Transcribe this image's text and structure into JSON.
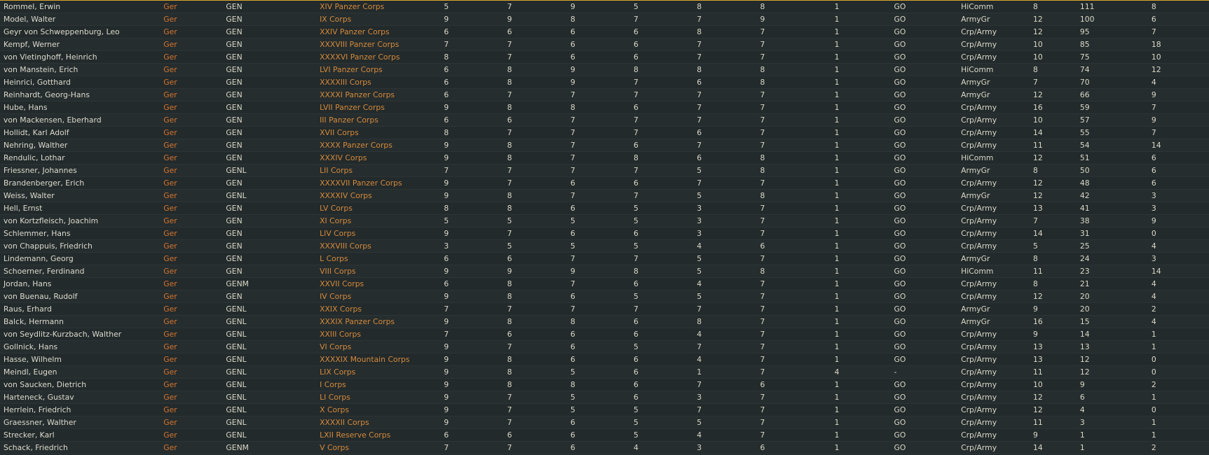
{
  "colors": {
    "background": "#232a2b",
    "row_alt": "#262d2e",
    "accent_rule": "#d7a631",
    "text": "#d9d9c9",
    "nationality": "#d4752e",
    "command": "#d48a3c"
  },
  "rows": [
    [
      "Rommel, Erwin",
      "Ger",
      "GEN",
      "XIV Panzer Corps",
      "5",
      "7",
      "9",
      "5",
      "8",
      "8",
      "1",
      "GO",
      "HiComm",
      "8",
      "111",
      "8"
    ],
    [
      "Model, Walter",
      "Ger",
      "GEN",
      "IX Corps",
      "9",
      "9",
      "8",
      "7",
      "7",
      "9",
      "1",
      "GO",
      "ArmyGr",
      "12",
      "100",
      "6"
    ],
    [
      "Geyr von Schweppenburg, Leo",
      "Ger",
      "GEN",
      "XXIV Panzer Corps",
      "6",
      "6",
      "6",
      "6",
      "8",
      "7",
      "1",
      "GO",
      "Crp/Army",
      "12",
      "95",
      "7"
    ],
    [
      "Kempf, Werner",
      "Ger",
      "GEN",
      "XXXVIII Panzer Corps",
      "7",
      "7",
      "6",
      "6",
      "7",
      "7",
      "1",
      "GO",
      "Crp/Army",
      "10",
      "85",
      "18"
    ],
    [
      "von Vietinghoff, Heinrich",
      "Ger",
      "GEN",
      "XXXXVI Panzer Corps",
      "8",
      "7",
      "6",
      "6",
      "7",
      "7",
      "1",
      "GO",
      "Crp/Army",
      "10",
      "75",
      "10"
    ],
    [
      "von Manstein, Erich",
      "Ger",
      "GEN",
      "LVI Panzer Corps",
      "6",
      "8",
      "9",
      "8",
      "8",
      "8",
      "1",
      "GO",
      "HiComm",
      "8",
      "74",
      "12"
    ],
    [
      "Heinrici, Gotthard",
      "Ger",
      "GEN",
      "XXXXIII Corps",
      "6",
      "8",
      "9",
      "7",
      "6",
      "8",
      "1",
      "GO",
      "ArmyGr",
      "7",
      "70",
      "4"
    ],
    [
      "Reinhardt, Georg-Hans",
      "Ger",
      "GEN",
      "XXXXI Panzer Corps",
      "6",
      "7",
      "7",
      "7",
      "7",
      "7",
      "1",
      "GO",
      "ArmyGr",
      "12",
      "66",
      "9"
    ],
    [
      "Hube, Hans",
      "Ger",
      "GEN",
      "LVII Panzer Corps",
      "9",
      "8",
      "8",
      "6",
      "7",
      "7",
      "1",
      "GO",
      "Crp/Army",
      "16",
      "59",
      "7"
    ],
    [
      "von Mackensen, Eberhard",
      "Ger",
      "GEN",
      "III Panzer Corps",
      "6",
      "6",
      "7",
      "7",
      "7",
      "7",
      "1",
      "GO",
      "Crp/Army",
      "10",
      "57",
      "9"
    ],
    [
      "Hollidt, Karl Adolf",
      "Ger",
      "GEN",
      "XVII Corps",
      "8",
      "7",
      "7",
      "7",
      "6",
      "7",
      "1",
      "GO",
      "Crp/Army",
      "14",
      "55",
      "7"
    ],
    [
      "Nehring, Walther",
      "Ger",
      "GEN",
      "XXXX Panzer Corps",
      "9",
      "8",
      "7",
      "6",
      "7",
      "7",
      "1",
      "GO",
      "Crp/Army",
      "11",
      "54",
      "14"
    ],
    [
      "Rendulic, Lothar",
      "Ger",
      "GEN",
      "XXXIV Corps",
      "9",
      "8",
      "7",
      "8",
      "6",
      "8",
      "1",
      "GO",
      "HiComm",
      "12",
      "51",
      "6"
    ],
    [
      "Friessner, Johannes",
      "Ger",
      "GENL",
      "LII Corps",
      "7",
      "7",
      "7",
      "7",
      "5",
      "8",
      "1",
      "GO",
      "ArmyGr",
      "8",
      "50",
      "6"
    ],
    [
      "Brandenberger, Erich",
      "Ger",
      "GEN",
      "XXXXVII Panzer Corps",
      "9",
      "7",
      "6",
      "6",
      "7",
      "7",
      "1",
      "GO",
      "Crp/Army",
      "12",
      "48",
      "6"
    ],
    [
      "Weiss, Walter",
      "Ger",
      "GENL",
      "XXXXIV Corps",
      "9",
      "8",
      "7",
      "7",
      "5",
      "8",
      "1",
      "GO",
      "ArmyGr",
      "12",
      "42",
      "3"
    ],
    [
      "Hell, Ernst",
      "Ger",
      "GEN",
      "LV Corps",
      "8",
      "8",
      "6",
      "5",
      "3",
      "7",
      "1",
      "GO",
      "Crp/Army",
      "13",
      "41",
      "3"
    ],
    [
      "von Kortzfleisch, Joachim",
      "Ger",
      "GEN",
      "XI Corps",
      "5",
      "5",
      "5",
      "5",
      "3",
      "7",
      "1",
      "GO",
      "Crp/Army",
      "7",
      "38",
      "9"
    ],
    [
      "Schlemmer, Hans",
      "Ger",
      "GEN",
      "LIV Corps",
      "9",
      "7",
      "6",
      "6",
      "3",
      "7",
      "1",
      "GO",
      "Crp/Army",
      "14",
      "31",
      "0"
    ],
    [
      "von Chappuis, Friedrich",
      "Ger",
      "GEN",
      "XXXVIII Corps",
      "3",
      "5",
      "5",
      "5",
      "4",
      "6",
      "1",
      "GO",
      "Crp/Army",
      "5",
      "25",
      "4"
    ],
    [
      "Lindemann, Georg",
      "Ger",
      "GEN",
      "L Corps",
      "6",
      "6",
      "7",
      "7",
      "5",
      "7",
      "1",
      "GO",
      "ArmyGr",
      "8",
      "24",
      "3"
    ],
    [
      "Schoerner, Ferdinand",
      "Ger",
      "GEN",
      "VIII Corps",
      "9",
      "9",
      "9",
      "8",
      "5",
      "8",
      "1",
      "GO",
      "HiComm",
      "11",
      "23",
      "14"
    ],
    [
      "Jordan, Hans",
      "Ger",
      "GENM",
      "XXVII Corps",
      "6",
      "8",
      "7",
      "6",
      "4",
      "7",
      "1",
      "GO",
      "Crp/Army",
      "8",
      "21",
      "4"
    ],
    [
      "von Buenau, Rudolf",
      "Ger",
      "GEN",
      "IV Corps",
      "9",
      "8",
      "6",
      "5",
      "5",
      "7",
      "1",
      "GO",
      "Crp/Army",
      "12",
      "20",
      "4"
    ],
    [
      "Raus, Erhard",
      "Ger",
      "GENL",
      "XXIX Corps",
      "7",
      "7",
      "7",
      "7",
      "7",
      "7",
      "1",
      "GO",
      "ArmyGr",
      "9",
      "20",
      "2"
    ],
    [
      "Balck, Hermann",
      "Ger",
      "GENL",
      "XXXIX Panzer Corps",
      "9",
      "8",
      "8",
      "6",
      "8",
      "7",
      "1",
      "GO",
      "ArmyGr",
      "16",
      "15",
      "4"
    ],
    [
      "von Seydlitz-Kurzbach, Walther",
      "Ger",
      "GENL",
      "XXIII Corps",
      "7",
      "6",
      "6",
      "6",
      "4",
      "7",
      "1",
      "GO",
      "Crp/Army",
      "9",
      "14",
      "1"
    ],
    [
      "Gollnick, Hans",
      "Ger",
      "GENL",
      "VI Corps",
      "9",
      "7",
      "6",
      "5",
      "7",
      "7",
      "1",
      "GO",
      "Crp/Army",
      "13",
      "13",
      "1"
    ],
    [
      "Hasse, Wilhelm",
      "Ger",
      "GENL",
      "XXXXIX Mountain Corps",
      "9",
      "8",
      "6",
      "6",
      "4",
      "7",
      "1",
      "GO",
      "Crp/Army",
      "13",
      "12",
      "0"
    ],
    [
      "Meindl, Eugen",
      "Ger",
      "GENL",
      "LIX Corps",
      "9",
      "8",
      "5",
      "6",
      "1",
      "7",
      "4",
      "-",
      "Crp/Army",
      "11",
      "12",
      "0"
    ],
    [
      "von Saucken, Dietrich",
      "Ger",
      "GENL",
      "I Corps",
      "9",
      "8",
      "8",
      "6",
      "7",
      "6",
      "1",
      "GO",
      "Crp/Army",
      "10",
      "9",
      "2"
    ],
    [
      "Harteneck, Gustav",
      "Ger",
      "GENL",
      "LI Corps",
      "9",
      "7",
      "5",
      "6",
      "3",
      "7",
      "1",
      "GO",
      "Crp/Army",
      "12",
      "6",
      "1"
    ],
    [
      "Herrlein, Friedrich",
      "Ger",
      "GENL",
      "X Corps",
      "9",
      "7",
      "5",
      "5",
      "7",
      "7",
      "1",
      "GO",
      "Crp/Army",
      "12",
      "4",
      "0"
    ],
    [
      "Graessner, Walther",
      "Ger",
      "GENL",
      "XXXXII Corps",
      "9",
      "7",
      "6",
      "5",
      "5",
      "7",
      "1",
      "GO",
      "Crp/Army",
      "11",
      "3",
      "1"
    ],
    [
      "Strecker, Karl",
      "Ger",
      "GENL",
      "LXII Reserve Corps",
      "6",
      "6",
      "6",
      "5",
      "4",
      "7",
      "1",
      "GO",
      "Crp/Army",
      "9",
      "1",
      "1"
    ],
    [
      "Schack, Friedrich",
      "Ger",
      "GENM",
      "V Corps",
      "7",
      "7",
      "6",
      "4",
      "3",
      "6",
      "1",
      "GO",
      "Crp/Army",
      "14",
      "1",
      "2"
    ]
  ]
}
